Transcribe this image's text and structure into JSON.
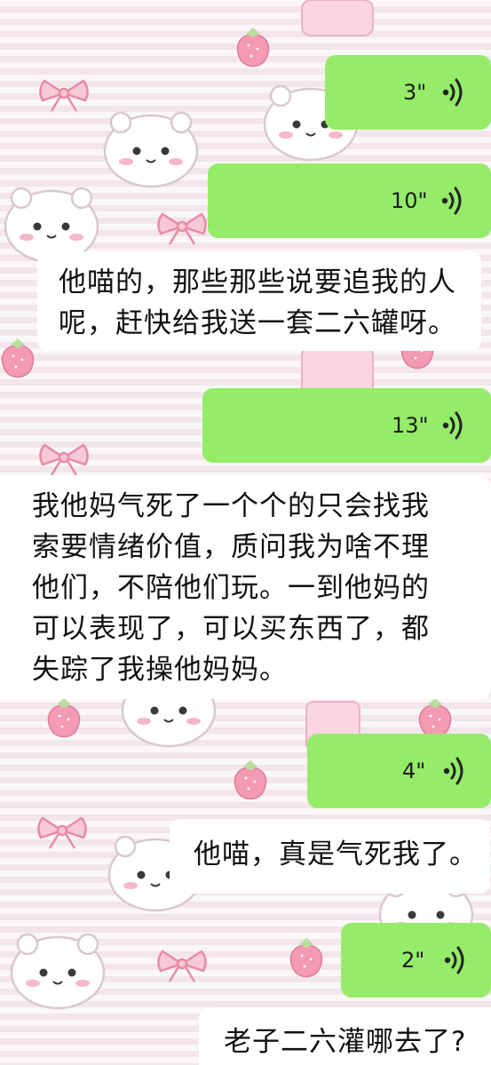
{
  "chat": {
    "messages": [
      {
        "type": "voice",
        "direction": "sent",
        "duration": "3\""
      },
      {
        "type": "voice",
        "direction": "sent",
        "duration": "10\""
      },
      {
        "type": "text",
        "direction": "received",
        "text": "他喵的，那些那些说要追我的人呢，赶快给我送一套二六罐呀。"
      },
      {
        "type": "voice",
        "direction": "sent",
        "duration": "13\""
      },
      {
        "type": "text",
        "direction": "received",
        "text": "我他妈气死了一个个的只会找我索要情绪价值，质问我为啥不理他们，不陪他们玩。一到他妈的可以表现了，可以买东西了，都失踪了我操他妈妈。"
      },
      {
        "type": "voice",
        "direction": "sent",
        "duration": "4\""
      },
      {
        "type": "text",
        "direction": "received",
        "text": "他喵，真是气死我了。"
      },
      {
        "type": "voice",
        "direction": "sent",
        "duration": "2\""
      },
      {
        "type": "text",
        "direction": "received",
        "text": "老子二六灌哪去了?"
      }
    ]
  },
  "colors": {
    "sent_bubble": "#95ec69",
    "received_bubble": "#ffffff",
    "wallpaper": "#f6eef2"
  },
  "icons": {
    "voice": "voice-wave-icon",
    "wallpaper": [
      "cartoon-hamster",
      "pink-bow",
      "strawberry"
    ]
  }
}
